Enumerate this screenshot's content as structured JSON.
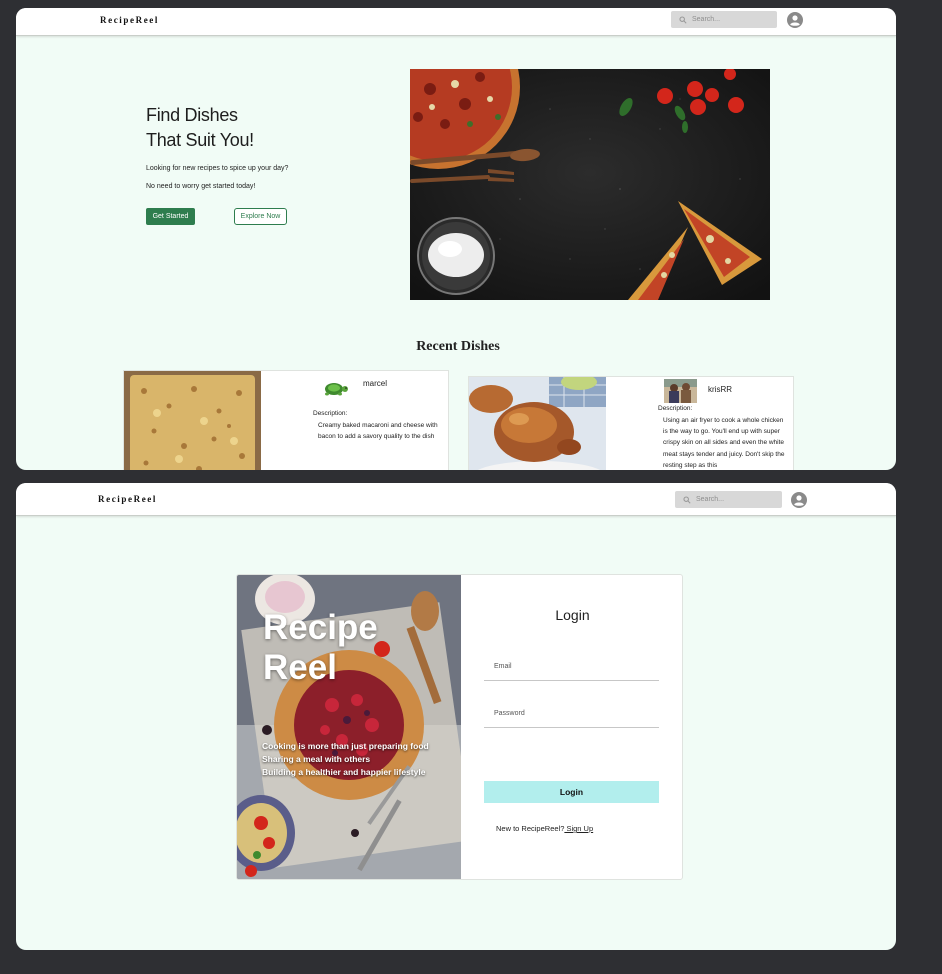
{
  "home": {
    "brand": "RecipeReel",
    "search_placeholder": "Search...",
    "hero": {
      "title_line1": "Find Dishes",
      "title_line2": "That Suit You!",
      "subtitle_line1": "Looking for new recipes to spice up your day?",
      "subtitle_line2": "No need to worry get started today!",
      "primary_button": "Get Started",
      "secondary_button": "Explore Now"
    },
    "recent": {
      "title": "Recent Dishes",
      "cards": [
        {
          "author": "marcel",
          "desc_label": "Description:",
          "description": "Creamy baked macaroni and cheese with bacon to add a savory quality to the dish"
        },
        {
          "author": "krisRR",
          "desc_label": "Description:",
          "description": "Using an air fryer to cook a whole chicken is the way to go. You'll end up with super crispy skin on all sides and even the white meat stays tender and juicy. Don't skip the resting step as this"
        }
      ]
    }
  },
  "login_page": {
    "brand": "RecipeReel",
    "search_placeholder": "Search...",
    "overlay": {
      "title_line1": "Recipe",
      "title_line2": "Reel",
      "line1": "Cooking is more than just preparing food",
      "line2": "Sharing a meal with others",
      "line3": "Building a healthier and happier lifestyle"
    },
    "heading": "Login",
    "email_placeholder": "Email",
    "password_placeholder": "Password",
    "login_button": "Login",
    "signup_prompt": "New to RecipeReel?",
    "signup_link": " Sign Up"
  },
  "colors": {
    "page_bg": "#2e2f33",
    "frame_bg": "#f1fcf6",
    "primary_green": "#2e7d4e",
    "login_button": "#b2eeed",
    "search_bg": "#d8d8d8"
  },
  "icons": [
    "search-icon",
    "user-avatar-icon"
  ]
}
